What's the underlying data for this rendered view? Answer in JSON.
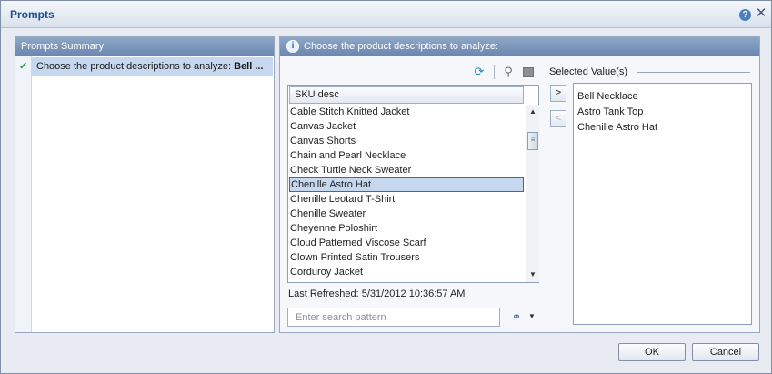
{
  "dialog": {
    "title": "Prompts",
    "help_icon": "?",
    "close_icon": "✕"
  },
  "summary": {
    "header": "Prompts Summary",
    "check_icon": "✔",
    "item_label": "Choose the product descriptions to analyze:",
    "item_value": "Bell ..."
  },
  "main": {
    "header": "Choose the product descriptions to analyze:",
    "info_icon": "i",
    "toolbar": {
      "refresh_icon": "⟳",
      "key_icon": "⚲"
    },
    "list": {
      "column_header": "SKU desc",
      "items": [
        "Cable Stitch Knitted Jacket",
        "Canvas Jacket",
        "Canvas Shorts",
        "Chain and Pearl Necklace",
        "Check Turtle Neck Sweater",
        "Chenille Astro Hat",
        "Chenille Leotard T-Shirt",
        "Chenille Sweater",
        "Cheyenne Poloshirt",
        "Cloud Patterned Viscose Scarf",
        "Clown Printed Satin Trousers",
        "Corduroy Jacket"
      ],
      "selected_index": 5,
      "scroll_up": "▲",
      "scroll_down": "▼",
      "scroll_thumb": "≡"
    },
    "last_refreshed": "Last Refreshed: 5/31/2012 10:36:57 AM",
    "search": {
      "placeholder": "Enter search pattern",
      "binoculars_icon": "⚭",
      "dropdown_icon": "▼"
    },
    "move_right_label": ">",
    "move_left_label": "<",
    "selected_values": {
      "label": "Selected Value(s)",
      "items": [
        "Bell Necklace",
        "Astro Tank Top",
        "Chenille Astro Hat"
      ]
    }
  },
  "buttons": {
    "ok": "OK",
    "cancel": "Cancel"
  }
}
